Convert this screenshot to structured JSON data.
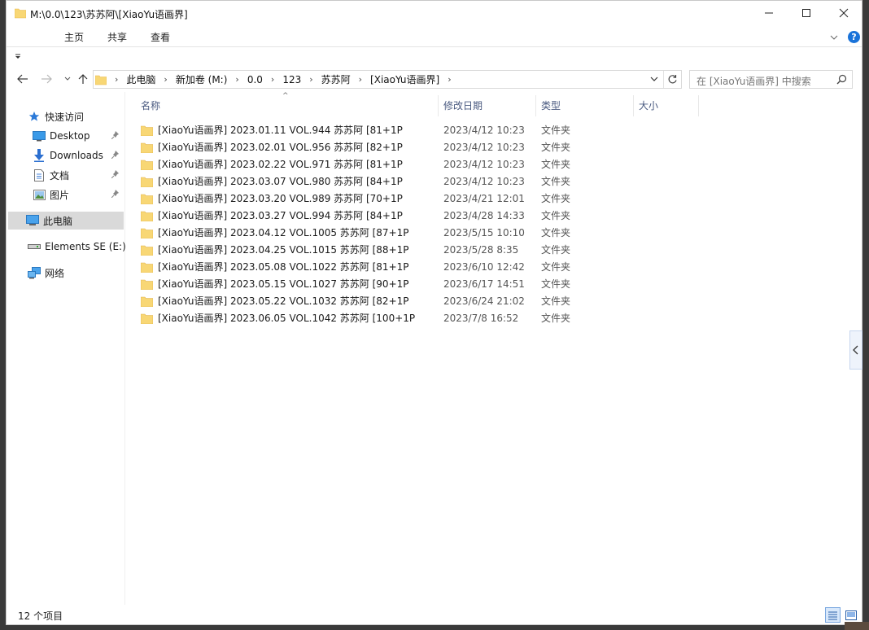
{
  "window": {
    "title": "M:\\0.0\\123\\苏苏阿\\[XiaoYu语画界]"
  },
  "ribbon": {
    "tabs": [
      {
        "label": "主页"
      },
      {
        "label": "共享"
      },
      {
        "label": "查看"
      }
    ],
    "help_label": "?"
  },
  "nav": {
    "breadcrumb": [
      "此电脑",
      "新加卷 (M:)",
      "0.0",
      "123",
      "苏苏阿",
      "[XiaoYu语画界]"
    ],
    "separator": "›",
    "search_placeholder": "在 [XiaoYu语画界] 中搜索"
  },
  "sidebar": {
    "items": [
      {
        "label": "快速访问",
        "icon": "star-icon"
      },
      {
        "label": "Desktop",
        "icon": "desktop-icon",
        "pinned": true
      },
      {
        "label": "Downloads",
        "icon": "download-icon",
        "pinned": true
      },
      {
        "label": "文档",
        "icon": "document-icon",
        "pinned": true
      },
      {
        "label": "图片",
        "icon": "picture-icon",
        "pinned": true
      },
      {
        "label": "此电脑",
        "icon": "computer-icon",
        "selected": true
      },
      {
        "label": "Elements SE (E:)",
        "icon": "drive-icon"
      },
      {
        "label": "网络",
        "icon": "network-icon"
      }
    ]
  },
  "columns": {
    "name": "名称",
    "modified": "修改日期",
    "type": "类型",
    "size": "大小",
    "sort_indicator": "^"
  },
  "files": [
    {
      "name": "[XiaoYu语画界] 2023.01.11 VOL.944 苏苏阿 [81+1P",
      "modified": "2023/4/12 10:23",
      "type": "文件夹"
    },
    {
      "name": "[XiaoYu语画界] 2023.02.01 VOL.956 苏苏阿 [82+1P",
      "modified": "2023/4/12 10:23",
      "type": "文件夹"
    },
    {
      "name": "[XiaoYu语画界] 2023.02.22 VOL.971 苏苏阿 [81+1P",
      "modified": "2023/4/12 10:23",
      "type": "文件夹"
    },
    {
      "name": "[XiaoYu语画界] 2023.03.07 VOL.980 苏苏阿 [84+1P",
      "modified": "2023/4/12 10:23",
      "type": "文件夹"
    },
    {
      "name": "[XiaoYu语画界] 2023.03.20 VOL.989 苏苏阿 [70+1P",
      "modified": "2023/4/21 12:01",
      "type": "文件夹"
    },
    {
      "name": "[XiaoYu语画界] 2023.03.27 VOL.994 苏苏阿 [84+1P",
      "modified": "2023/4/28 14:33",
      "type": "文件夹"
    },
    {
      "name": "[XiaoYu语画界] 2023.04.12 VOL.1005 苏苏阿 [87+1P",
      "modified": "2023/5/15 10:10",
      "type": "文件夹"
    },
    {
      "name": "[XiaoYu语画界] 2023.04.25 VOL.1015 苏苏阿 [88+1P",
      "modified": "2023/5/28 8:35",
      "type": "文件夹"
    },
    {
      "name": "[XiaoYu语画界] 2023.05.08 VOL.1022 苏苏阿 [81+1P",
      "modified": "2023/6/10 12:42",
      "type": "文件夹"
    },
    {
      "name": "[XiaoYu语画界] 2023.05.15 VOL.1027 苏苏阿 [90+1P",
      "modified": "2023/6/17 14:51",
      "type": "文件夹"
    },
    {
      "name": "[XiaoYu语画界] 2023.05.22 VOL.1032 苏苏阿 [82+1P",
      "modified": "2023/6/24 21:02",
      "type": "文件夹"
    },
    {
      "name": "[XiaoYu语画界] 2023.06.05 VOL.1042 苏苏阿 [100+1P",
      "modified": "2023/7/8 16:52",
      "type": "文件夹"
    }
  ],
  "status": {
    "item_count": "12 个项目"
  },
  "colors": {
    "folder": "#f8d775",
    "folder_dark": "#e8b84a",
    "accent": "#1a73d9",
    "selected_bg": "#d9d9d9"
  }
}
